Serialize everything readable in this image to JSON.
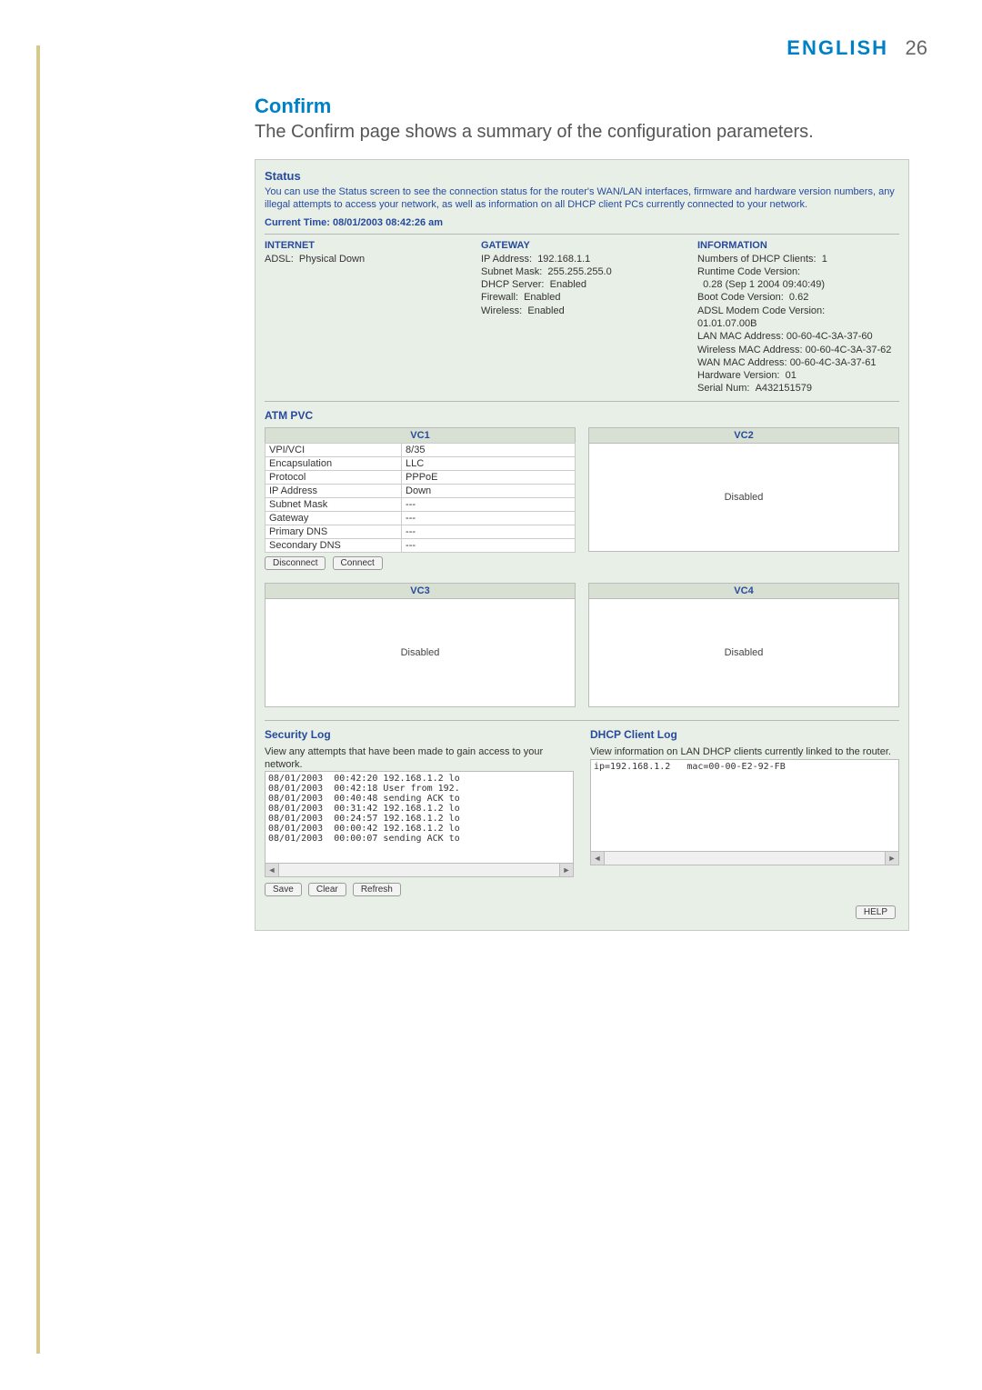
{
  "header": {
    "language": "ENGLISH",
    "page": "26"
  },
  "section": {
    "title": "Confirm",
    "lead": "The Confirm page shows a summary of the configuration parameters."
  },
  "status": {
    "heading": "Status",
    "description": "You can use the Status screen to see the connection status for the router's WAN/LAN interfaces, firmware and hardware version numbers, any illegal attempts to access your network, as well as information on all DHCP client PCs currently connected to your network.",
    "current_time": "Current Time: 08/01/2003 08:42:26 am",
    "internet": {
      "heading": "INTERNET",
      "adsl_label": "ADSL:",
      "adsl_value": "Physical Down"
    },
    "gateway": {
      "heading": "GATEWAY",
      "ip_label": "IP Address:",
      "ip": "192.168.1.1",
      "mask_label": "Subnet Mask:",
      "mask": "255.255.255.0",
      "dhcp_label": "DHCP Server:",
      "dhcp": "Enabled",
      "firewall_label": "Firewall:",
      "firewall": "Enabled",
      "wireless_label": "Wireless:",
      "wireless": "Enabled"
    },
    "info": {
      "heading": "INFORMATION",
      "dhcp_clients_label": "Numbers of DHCP Clients:",
      "dhcp_clients": "1",
      "runtime_label": "Runtime Code Version:",
      "runtime": "0.28 (Sep 1 2004 09:40:49)",
      "boot_label": "Boot Code Version:",
      "boot": "0.62",
      "adsl_modem_label": "ADSL Modem Code Version:",
      "adsl_modem": "01.01.07.00B",
      "lan_mac_label": "LAN MAC Address:",
      "lan_mac": "00-60-4C-3A-37-60",
      "wlan_mac_label": "Wireless MAC Address:",
      "wlan_mac": "00-60-4C-3A-37-62",
      "wan_mac_label": "WAN MAC Address:",
      "wan_mac": "00-60-4C-3A-37-61",
      "hw_label": "Hardware Version:",
      "hw": "01",
      "serial_label": "Serial Num:",
      "serial": "A432151579"
    }
  },
  "atm": {
    "heading": "ATM PVC",
    "labels": {
      "vpivci": "VPI/VCI",
      "encap": "Encapsulation",
      "protocol": "Protocol",
      "ip": "IP Address",
      "mask": "Subnet Mask",
      "gateway": "Gateway",
      "pdns": "Primary DNS",
      "sdns": "Secondary DNS"
    },
    "buttons": {
      "disconnect": "Disconnect",
      "connect": "Connect"
    },
    "vc1": {
      "name": "VC1",
      "vpivci": "8/35",
      "encap": "LLC",
      "protocol": "PPPoE",
      "ip": "Down",
      "mask": "---",
      "gateway": "---",
      "pdns": "---",
      "sdns": "---"
    },
    "vc2": {
      "name": "VC2",
      "state": "Disabled"
    },
    "vc3": {
      "name": "VC3",
      "state": "Disabled"
    },
    "vc4": {
      "name": "VC4",
      "state": "Disabled"
    }
  },
  "logs": {
    "security": {
      "heading": "Security Log",
      "desc": "View any attempts that have been made to gain access to your network.",
      "content": "08/01/2003  00:42:20 192.168.1.2 lo\n08/01/2003  00:42:18 User from 192.\n08/01/2003  00:40:48 sending ACK to\n08/01/2003  00:31:42 192.168.1.2 lo\n08/01/2003  00:24:57 192.168.1.2 lo\n08/01/2003  00:00:42 192.168.1.2 lo\n08/01/2003  00:00:07 sending ACK to"
    },
    "dhcp": {
      "heading": "DHCP Client Log",
      "desc": "View information on LAN DHCP clients currently linked to the router.",
      "content": "ip=192.168.1.2   mac=00-00-E2-92-FB"
    },
    "buttons": {
      "save": "Save",
      "clear": "Clear",
      "refresh": "Refresh"
    }
  },
  "help_label": "HELP"
}
